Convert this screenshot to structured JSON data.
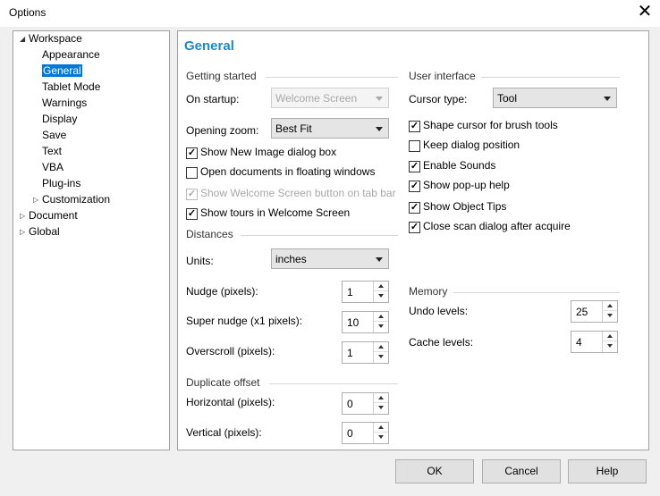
{
  "window": {
    "title": "Options",
    "close_icon": "close-icon"
  },
  "tree": {
    "items": [
      {
        "label": "Workspace",
        "toggle": "◢"
      },
      {
        "label": "Appearance"
      },
      {
        "label": "General"
      },
      {
        "label": "Tablet Mode"
      },
      {
        "label": "Warnings"
      },
      {
        "label": "Display"
      },
      {
        "label": "Save"
      },
      {
        "label": "Text"
      },
      {
        "label": "VBA"
      },
      {
        "label": "Plug-ins"
      },
      {
        "label": "Customization",
        "toggle": "▷"
      },
      {
        "label": "Document",
        "toggle": "▷"
      },
      {
        "label": "Global",
        "toggle": "▷"
      }
    ],
    "selected": "General"
  },
  "panel": {
    "title": "General",
    "getting_started": {
      "heading": "Getting started",
      "on_startup_label": "On startup:",
      "on_startup_value": "Welcome Screen",
      "opening_zoom_label": "Opening zoom:",
      "opening_zoom_value": "Best Fit",
      "checkboxes": [
        {
          "label": "Show New Image dialog box",
          "checked": true,
          "mark": "✓"
        },
        {
          "label": "Open documents in floating windows",
          "checked": false,
          "mark": ""
        },
        {
          "label": "Show Welcome Screen button on tab bar",
          "checked": true,
          "mark": "✓",
          "disabled": true
        },
        {
          "label": "Show tours in Welcome Screen",
          "checked": true,
          "mark": "✓"
        }
      ]
    },
    "distances": {
      "heading": "Distances",
      "units_label": "Units:",
      "units_value": "inches",
      "nudge_label": "Nudge (pixels):",
      "nudge_value": "1",
      "super_nudge_label": "Super nudge (x1 pixels):",
      "super_nudge_value": "10",
      "overscroll_label": "Overscroll (pixels):",
      "overscroll_value": "1"
    },
    "duplicate_offset": {
      "heading": "Duplicate offset",
      "horizontal_label": "Horizontal (pixels):",
      "horizontal_value": "0",
      "vertical_label": "Vertical (pixels):",
      "vertical_value": "0"
    },
    "user_interface": {
      "heading": "User interface",
      "cursor_type_label": "Cursor type:",
      "cursor_type_value": "Tool",
      "checkboxes": [
        {
          "label": "Shape cursor for brush tools",
          "checked": true,
          "mark": "✓"
        },
        {
          "label": "Keep dialog position",
          "checked": false,
          "mark": ""
        },
        {
          "label": "Enable Sounds",
          "checked": true,
          "mark": "✓"
        },
        {
          "label": "Show pop-up help",
          "checked": true,
          "mark": "✓"
        },
        {
          "label": "Show Object Tips",
          "checked": true,
          "mark": "✓"
        },
        {
          "label": "Close scan dialog after acquire",
          "checked": true,
          "mark": "✓"
        }
      ]
    },
    "memory": {
      "heading": "Memory",
      "undo_label": "Undo levels:",
      "undo_value": "25",
      "cache_label": "Cache levels:",
      "cache_value": "4"
    }
  },
  "buttons": {
    "ok": "OK",
    "cancel": "Cancel",
    "help": "Help"
  }
}
